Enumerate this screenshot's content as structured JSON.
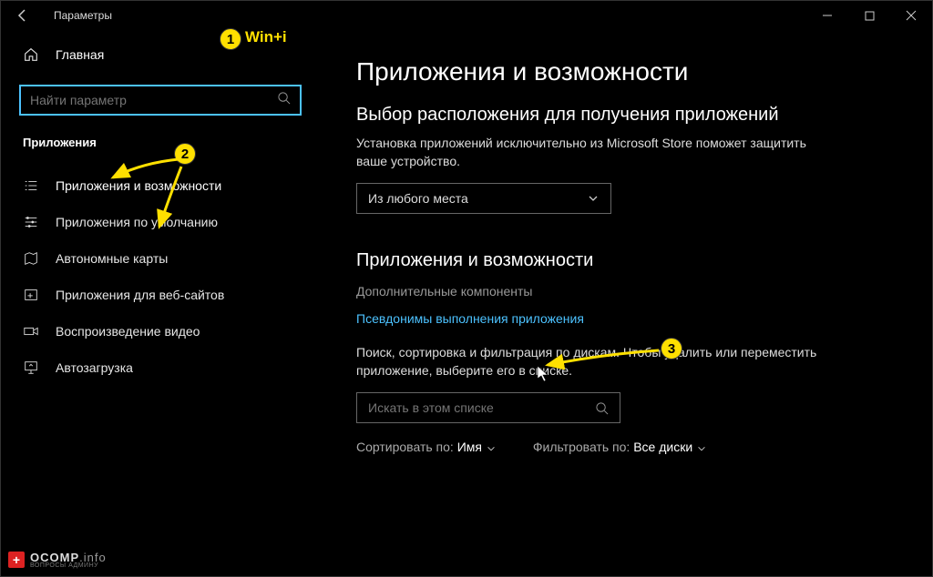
{
  "title": "Параметры",
  "annotations": {
    "badge1": "1",
    "badge1_label": "Win+i",
    "badge2": "2",
    "badge3": "3"
  },
  "sidebar": {
    "home": "Главная",
    "search_placeholder": "Найти параметр",
    "section": "Приложения",
    "items": [
      "Приложения и возможности",
      "Приложения по умолчанию",
      "Автономные карты",
      "Приложения для веб-сайтов",
      "Воспроизведение видео",
      "Автозагрузка"
    ]
  },
  "main": {
    "h1": "Приложения и возможности",
    "section1_title": "Выбор расположения для получения приложений",
    "section1_desc": "Установка приложений исключительно из Microsoft Store поможет защитить ваше устройство.",
    "dropdown_value": "Из любого места",
    "section2_title": "Приложения и возможности",
    "link_gray": "Дополнительные компоненты",
    "link_blue": "Псевдонимы выполнения приложения",
    "filter_desc": "Поиск, сортировка и фильтрация по дискам. Чтобы удалить или переместить приложение, выберите его в списке.",
    "search2_placeholder": "Искать в этом списке",
    "sort_label": "Сортировать по:",
    "sort_value": "Имя",
    "filter_label": "Фильтровать по:",
    "filter_value": "Все диски"
  },
  "colors": {
    "accent": "#4cc2ff",
    "anno": "#ffe000"
  },
  "footer": {
    "brand1": "OCOMP",
    "brand2": ".info",
    "sub": "ВОПРОСЫ АДМИНУ"
  }
}
